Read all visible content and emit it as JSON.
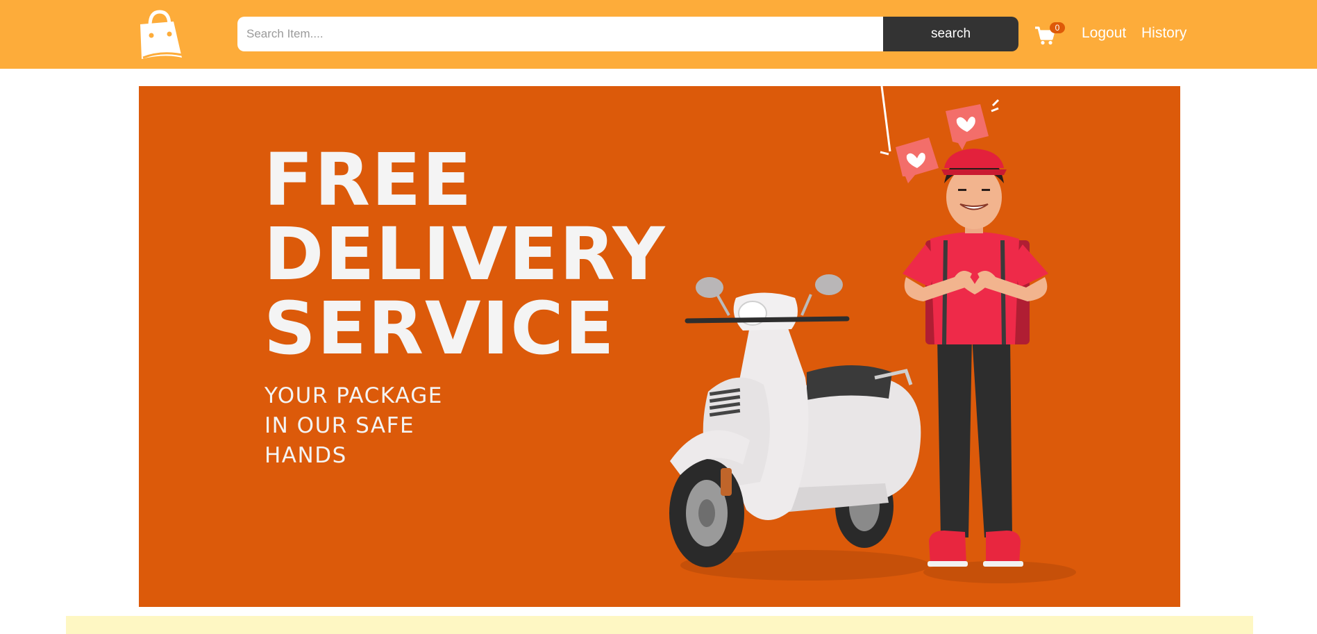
{
  "header": {
    "search": {
      "placeholder": "Search Item....",
      "value": "",
      "button_label": "search"
    },
    "cart": {
      "count": "0"
    },
    "links": {
      "logout": "Logout",
      "history": "History"
    }
  },
  "banner": {
    "headline": [
      "FREE",
      "DELIVERY",
      "SERVICE"
    ],
    "subline": [
      "YOUR PACKAGE",
      "IN OUR SAFE",
      "HANDS"
    ]
  },
  "colors": {
    "navbar": "#FDAC3A",
    "banner_bg": "#DC5A0A",
    "search_button": "#333333",
    "strip": "#FEF7C3"
  },
  "icons": {
    "logo": "shopping-bag-icon",
    "cart": "shopping-cart-icon"
  }
}
